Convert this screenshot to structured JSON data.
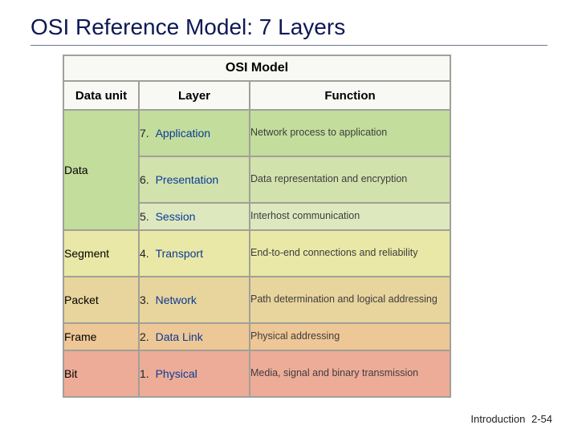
{
  "title": "OSI Reference Model: 7 Layers",
  "table": {
    "caption": "OSI Model",
    "headers": {
      "data_unit": "Data unit",
      "layer": "Layer",
      "function": "Function"
    },
    "data_units": {
      "data": "Data",
      "segment": "Segment",
      "packet": "Packet",
      "frame": "Frame",
      "bit": "Bit"
    },
    "layers": {
      "l7": {
        "num": "7.",
        "name": "Application",
        "func": "Network process to application"
      },
      "l6": {
        "num": "6.",
        "name": "Presentation",
        "func": "Data representation and encryption"
      },
      "l5": {
        "num": "5.",
        "name": "Session",
        "func": "Interhost communication"
      },
      "l4": {
        "num": "4.",
        "name": "Transport",
        "func": "End-to-end connections and reliability"
      },
      "l3": {
        "num": "3.",
        "name": "Network",
        "func": "Path determination and logical addressing"
      },
      "l2": {
        "num": "2.",
        "name": "Data Link",
        "func": "Physical addressing"
      },
      "l1": {
        "num": "1.",
        "name": "Physical",
        "func": "Media, signal and binary transmission"
      }
    }
  },
  "footer": {
    "label": "Introduction",
    "page": "2-54"
  }
}
